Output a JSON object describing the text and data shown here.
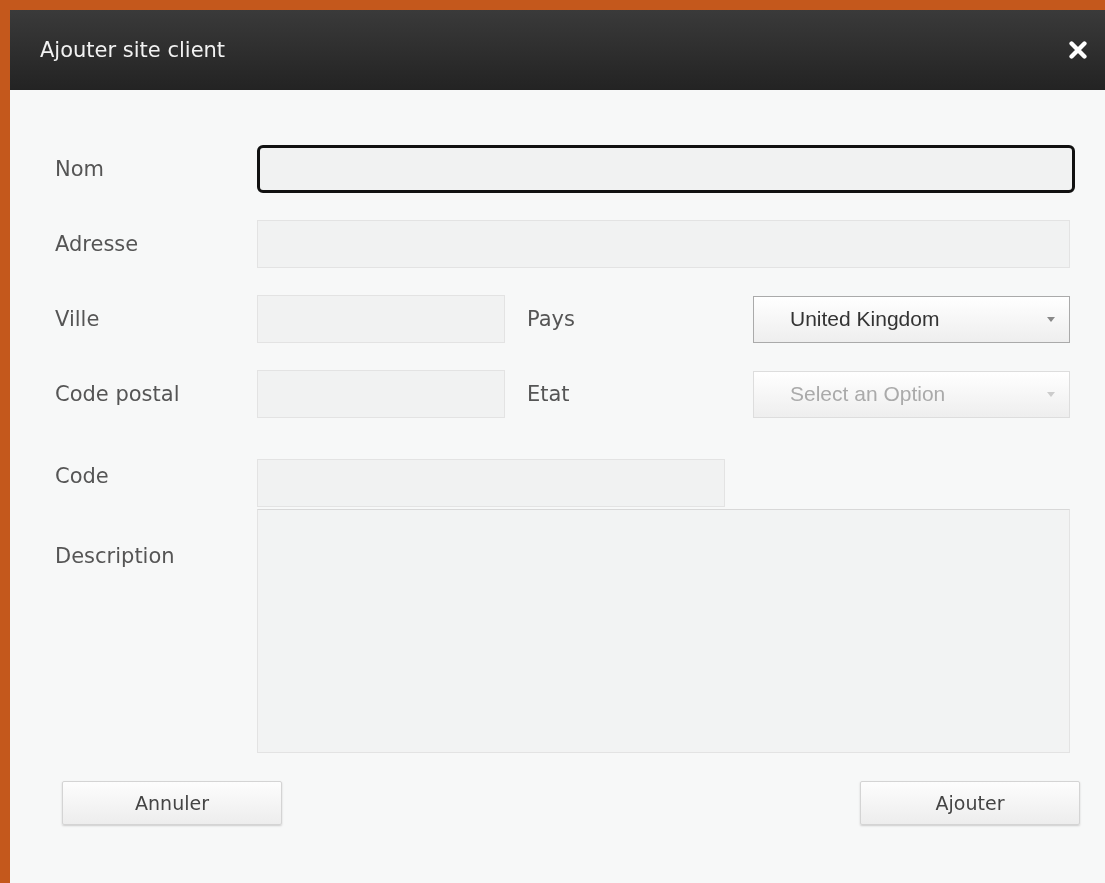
{
  "dialog": {
    "title": "Ajouter site client"
  },
  "rows": [
    {
      "fields": [
        {
          "label": "Nom",
          "kind": "text",
          "focused": true
        }
      ]
    },
    {
      "fields": [
        {
          "label": "Adresse",
          "kind": "text",
          "focused": false
        }
      ]
    },
    {
      "fields": [
        {
          "label": "Ville",
          "kind": "text",
          "focused": false
        },
        {
          "label": "Pays",
          "kind": "select",
          "value": "United Kingdom",
          "disabled": false
        }
      ]
    },
    {
      "fields": [
        {
          "label": "Code postal",
          "kind": "text",
          "focused": false
        },
        {
          "label": "Etat",
          "kind": "select",
          "value": "Select an Option",
          "disabled": true
        }
      ]
    },
    {
      "fields": [
        {
          "label": "Code",
          "kind": "short-text",
          "focused": false
        }
      ]
    },
    {
      "fields": [
        {
          "label": "Description",
          "kind": "textarea",
          "focused": false
        }
      ]
    }
  ],
  "buttons": [
    {
      "label": "Annuler"
    },
    {
      "label": "Ajouter"
    }
  ]
}
